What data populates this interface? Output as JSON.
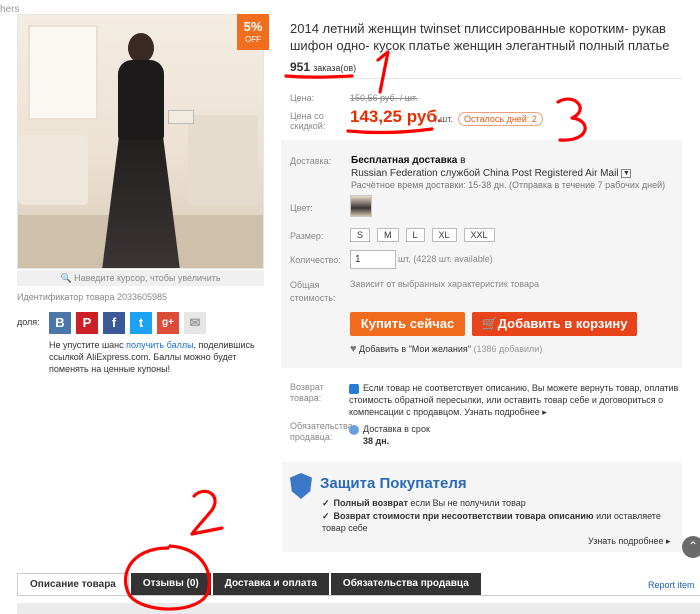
{
  "breadcrumb": "hers",
  "product": {
    "title": "2014 летний женщин twinset плиссированные коротким- рукав шифон одно- кусок платье женщин элегантный полный платье",
    "orders_count": "951",
    "orders_suffix": "заказа(ов)",
    "sale_badge_pct": "5",
    "sale_badge_off": "OFF",
    "zoom_hint": "Наведите курсор, чтобы увеличить",
    "id_text": "Идентификатор товара 2033605985"
  },
  "share": {
    "label": "доля:",
    "icons": [
      "vk-icon",
      "pinterest-icon",
      "facebook-icon",
      "twitter-icon",
      "googleplus-icon",
      "email-icon"
    ],
    "points_pre": "Не упустите шанс ",
    "points_link": "получить баллы",
    "points_post": ", поделившись ссылкой AliExpress.com. Баллы можно будет поменять на ценные купоны!"
  },
  "price": {
    "label": "Цена:",
    "old": "150,56 руб. / шт.",
    "discount_label": "Цена со скидкой:",
    "new": "143,25 руб.",
    "unit": "/ шт.",
    "days_left": "Осталось дней: 2"
  },
  "shipping": {
    "label": "Доставка:",
    "title": "Бесплатная доставка",
    "title_suffix": " в",
    "line": "Russian Federation службой China Post Registered Air Mail",
    "time": "Расчётное время доставки: 15-38 дн. (Отправка в течение 7 рабочих дней)"
  },
  "color": {
    "label": "Цвет:"
  },
  "size": {
    "label": "Размер:",
    "options": [
      "S",
      "M",
      "L",
      "XL",
      "XXL"
    ]
  },
  "quantity": {
    "label": "Количество:",
    "value": "1",
    "note": "шт. (4228 шт. available)"
  },
  "total": {
    "label": "Общая стоимость:",
    "note": "Зависит от выбранных характеристик товара"
  },
  "buttons": {
    "buy": "Купить сейчас",
    "cart": "Добавить в корзину"
  },
  "wishlist": {
    "text": "Добавить в \"Мои желания\"",
    "count": "(1386 добавили)"
  },
  "returns": {
    "label": "Возврат товара:",
    "text": "Если товар не соответствует описанию, Вы можете вернуть товар, оплатив стоимость обратной пересылки, или оставить товар себе и договориться о компенсации с продавцом.",
    "more": "Узнать подробнее ▸"
  },
  "seller_oblig": {
    "label": "Обязательства продавца:",
    "text": "Доставка в срок",
    "days": "38 дн."
  },
  "protection": {
    "title": "Защита Покупателя",
    "line1_bold": "Полный возврат",
    "line1_rest": " если Вы не получили товар",
    "line2_bold": "Возврат стоимости при несоответствии товара описанию",
    "line2_rest": " или оставляете товар себе",
    "more": "Узнать подробнее ▸"
  },
  "tabs": [
    "Описание товара",
    "Отзывы (0)",
    "Доставка и оплата",
    "Обязательства продавца"
  ],
  "report": "Report item",
  "annotations": [
    "1",
    "2",
    "3"
  ],
  "colors": {
    "price": "#e62e04",
    "buy": "#f26a1b",
    "cart": "#e8441a",
    "annotation": "#ff0000",
    "link": "#1a73c8"
  }
}
